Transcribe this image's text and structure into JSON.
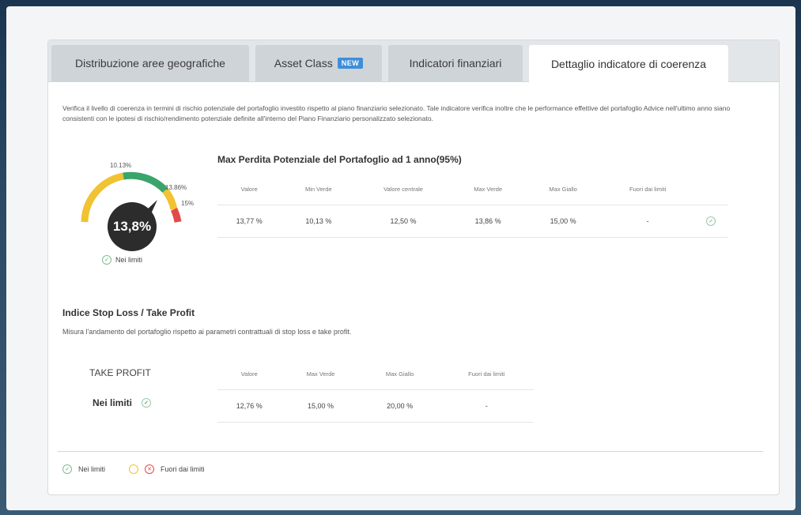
{
  "tabs": [
    {
      "label": "Distribuzione aree geografiche"
    },
    {
      "label": "Asset Class",
      "badge": "NEW"
    },
    {
      "label": "Indicatori finanziari"
    },
    {
      "label": "Dettaglio indicatore di coerenza"
    }
  ],
  "description": "Verifica il livello di coerenza in termini di rischio potenziale del portafoglio investito rispetto al piano finanziario selezionato. Tale indicatore verifica inoltre che le performance effettive del portafoglio Advice nell'ultimo anno siano consistenti con le ipotesi di rischio/rendimento potenziale definite all'interno del Piano Finanziario personalizzato selezionato.",
  "gauge": {
    "value_label": "13,8%",
    "value": 13.8,
    "ticks": {
      "left": "10.13%",
      "right": "13.86%",
      "end": "15%"
    },
    "status": "Nei limiti",
    "colors": {
      "green": "#3aa56a",
      "yellow": "#f1c232",
      "red": "#e24a4a",
      "center": "#2c2c2c"
    }
  },
  "max_loss": {
    "title": "Max Perdita Potenziale del Portafoglio ad 1 anno(95%)",
    "headers": [
      "Valore",
      "Min Verde",
      "Valore centrale",
      "Max Verde",
      "Max Giallo",
      "Fuori dai limiti"
    ],
    "row": [
      "13,77 %",
      "10,13 %",
      "12,50 %",
      "13,86 %",
      "15,00 %",
      "-"
    ]
  },
  "stop_loss": {
    "title": "Indice Stop Loss / Take Profit",
    "desc": "Misura l'andamento del portafoglio rispetto ai parametri contrattuali di stop loss e take profit.",
    "section_label": "TAKE PROFIT",
    "status": "Nei limiti",
    "headers": [
      "Valore",
      "Max Verde",
      "Max Giallo",
      "Fuori dai limiti"
    ],
    "row": [
      "12,76 %",
      "15,00 %",
      "20,00 %",
      "-"
    ]
  },
  "legend": {
    "in_limits": "Nei limiti",
    "out_limits": "Fuori dai limiti"
  }
}
